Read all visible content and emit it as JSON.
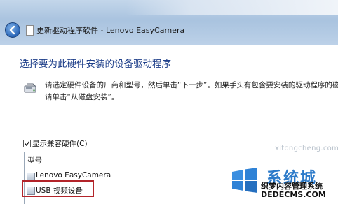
{
  "window": {
    "title": "更新驱动程序软件 - Lenovo EasyCamera"
  },
  "page": {
    "heading": "选择要为此硬件安装的设备驱动程序",
    "instructions_line1": "请选定硬件设备的厂商和型号，然后单击“下一步”。如果手头有包含要安装的驱动程序的磁",
    "instructions_line2": "请单击“从磁盘安装”。"
  },
  "compatible_checkbox": {
    "label": "显示兼容硬件(",
    "accel": "C",
    "label_end": ")",
    "checked": true
  },
  "model_list": {
    "header": "型号",
    "items": [
      {
        "label": "Lenovo EasyCamera",
        "highlighted": false
      },
      {
        "label": "USB 视频设备",
        "highlighted": true
      }
    ]
  },
  "watermark": {
    "site_small": "xitongcheng.com",
    "brand_big": "系统城",
    "sub1": "织梦内容管理系统",
    "sub2": "DEDECMS.COM"
  },
  "colors": {
    "heading": "#1e3f8a",
    "highlight_border": "#b3242a",
    "watermark_blue": "#2c7ac9"
  }
}
